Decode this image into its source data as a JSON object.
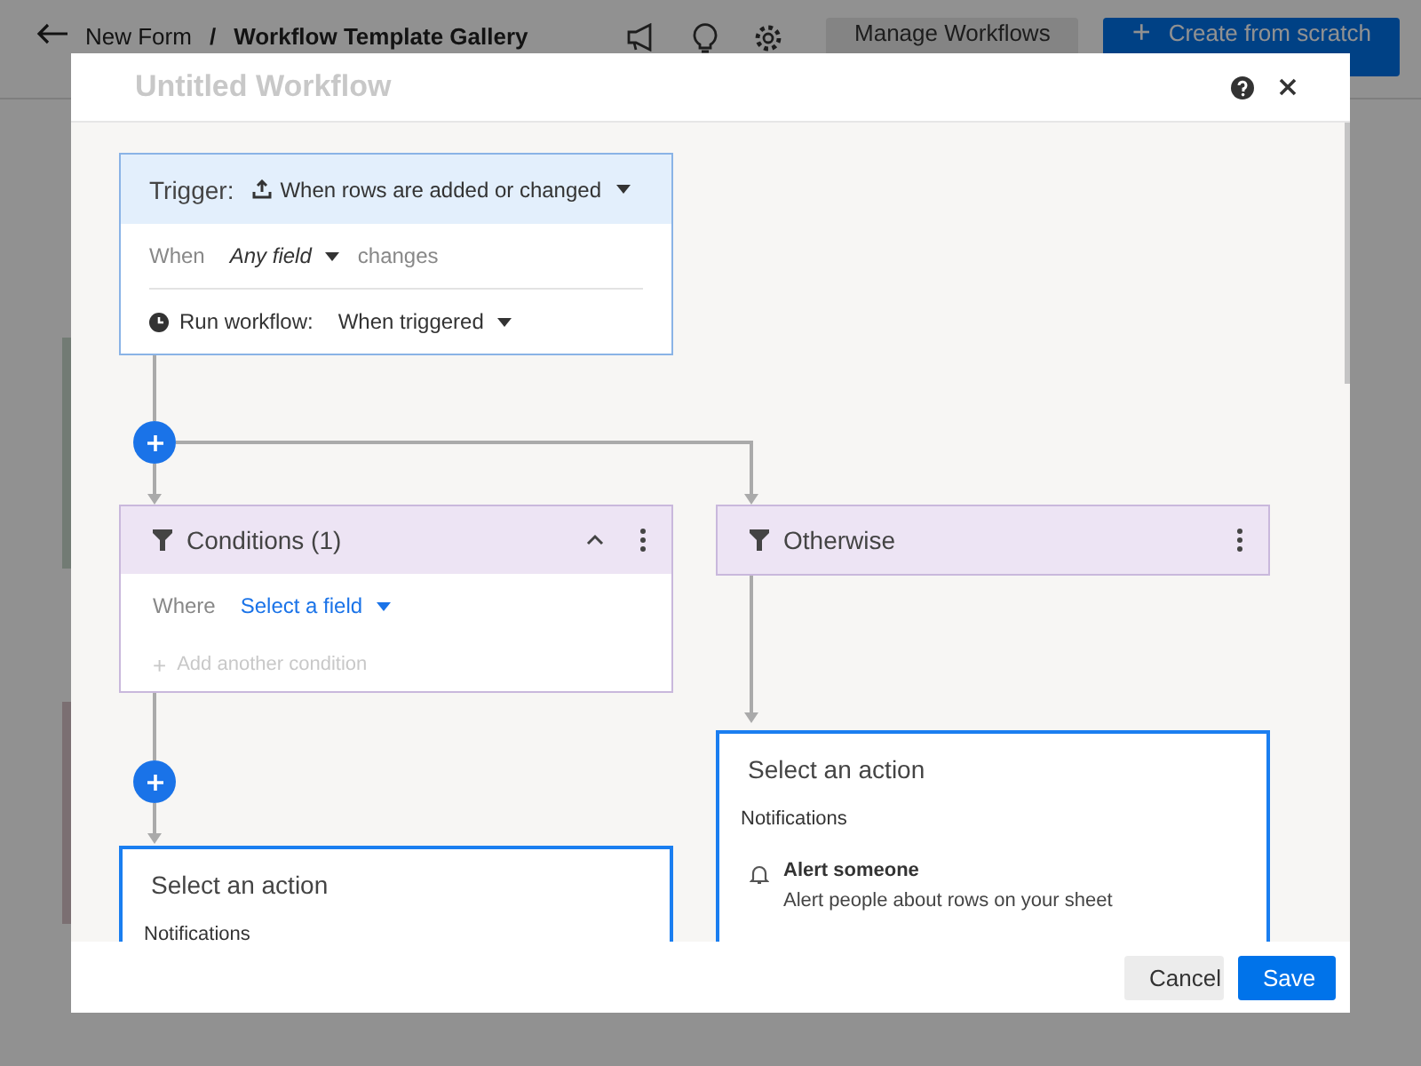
{
  "background": {
    "breadcrumb": [
      "New Form",
      "/",
      "Workflow Template Gallery"
    ],
    "buttons": [
      {
        "label": "Manage Workflows",
        "kind": "secondary"
      },
      {
        "label": "+",
        "kind": "primary",
        "text": "Create from scratch"
      }
    ]
  },
  "dialog": {
    "title": "Untitled Workflow",
    "trigger": {
      "label": "Trigger:",
      "event": "When rows are added or changed",
      "when_label": "When",
      "field": "Any field",
      "field_suffix": "changes",
      "run_label": "Run workflow:",
      "run_value": "When triggered"
    },
    "conditions": {
      "title": "Conditions (1)",
      "expanded": true,
      "where_label": "Where",
      "field_placeholder": "Select a field",
      "add_condition": {
        "icon": "+",
        "label": "Add another condition",
        "disabled": true
      }
    },
    "otherwise": {
      "title": "Otherwise"
    },
    "actions": [
      {
        "title": "Select an action",
        "sections": [
          {
            "heading": "Notifications"
          }
        ]
      },
      {
        "title": "Select an action",
        "sections": [
          {
            "heading": "Notifications",
            "items": [
              {
                "title": "Alert someone",
                "description": "Alert people about rows on your sheet"
              }
            ]
          }
        ]
      }
    ],
    "footer_buttons": [
      {
        "label": "Cancel",
        "kind": "secondary"
      },
      {
        "label": "Save",
        "kind": "primary"
      }
    ]
  }
}
